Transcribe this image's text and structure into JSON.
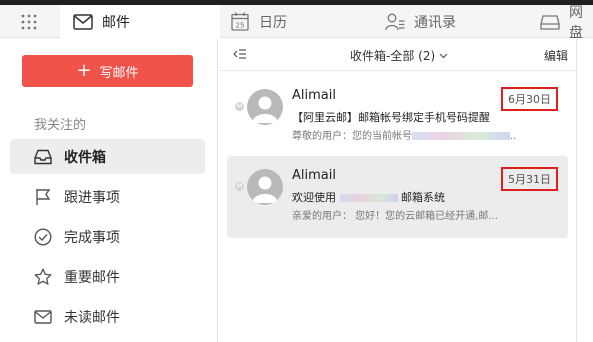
{
  "tabs": [
    {
      "label": "邮件",
      "icon": "mail-icon",
      "active": true
    },
    {
      "label": "日历",
      "icon": "calendar-icon",
      "active": false,
      "calendar_day": "25"
    },
    {
      "label": "通讯录",
      "icon": "contacts-icon",
      "active": false
    },
    {
      "label": "网盘",
      "icon": "disk-icon",
      "active": false
    }
  ],
  "sidebar": {
    "compose_label": "写邮件",
    "section_title": "我关注的",
    "items": [
      {
        "label": "收件箱",
        "icon": "inbox-icon",
        "active": true
      },
      {
        "label": "跟进事项",
        "icon": "flag-icon",
        "active": false
      },
      {
        "label": "完成事项",
        "icon": "check-circle-icon",
        "active": false
      },
      {
        "label": "重要邮件",
        "icon": "star-icon",
        "active": false
      },
      {
        "label": "未读邮件",
        "icon": "unread-mail-icon",
        "active": false
      }
    ]
  },
  "list": {
    "folder_label": "收件箱-全部 (2)",
    "edit_label": "编辑",
    "mails": [
      {
        "sender": "Alimail",
        "subject": "【阿里云邮】邮箱帐号绑定手机号码提醒",
        "preview_prefix": "尊敬的用户：您的当前帐号",
        "preview_suffix": "..",
        "date": "6月30日",
        "selected": false
      },
      {
        "sender": "Alimail",
        "subject_prefix": "欢迎使用",
        "subject_suffix": "邮箱系统",
        "preview": "亲爱的用户：  您好！您的云邮箱已经开通,邮...",
        "date": "5月31日",
        "selected": true
      }
    ]
  },
  "colors": {
    "accent": "#f0534a",
    "highlight_box": "#e02020",
    "selected_bg": "#ececec"
  }
}
